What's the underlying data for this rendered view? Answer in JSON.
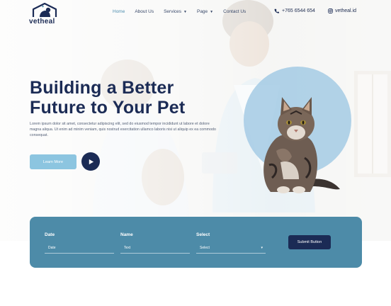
{
  "header": {
    "logo_text": "vetheal",
    "nav": [
      {
        "label": "Home",
        "active": true,
        "dropdown": false
      },
      {
        "label": "About Us",
        "active": false,
        "dropdown": false
      },
      {
        "label": "Services",
        "active": false,
        "dropdown": true
      },
      {
        "label": "Page",
        "active": false,
        "dropdown": true
      },
      {
        "label": "Contact Us",
        "active": false,
        "dropdown": false
      }
    ],
    "phone": "+765 6544 654",
    "social": "vetheal.id"
  },
  "hero": {
    "title_line1": "Building a Better",
    "title_line2": "Future to Your Pet",
    "description": "Lorem ipsum dolor sit amet, consectetur adipiscing elit, sed do eiusmod tempor incididunt ut labore et dolore magna aliqua. Ut enim ad minim veniam, quis nostrud exercitation ullamco laboris nisi ut aliquip ex ea commodo consequat.",
    "learn_more_label": "Learn More"
  },
  "form": {
    "fields": [
      {
        "label": "Date",
        "value": "Date"
      },
      {
        "label": "Name",
        "value": "Text"
      },
      {
        "label": "Select",
        "value": "Select"
      }
    ],
    "submit_label": "Submit Button"
  },
  "colors": {
    "navy": "#1b2b55",
    "accent_blue": "#8cc5e0",
    "panel_blue": "#4d8ba8"
  }
}
